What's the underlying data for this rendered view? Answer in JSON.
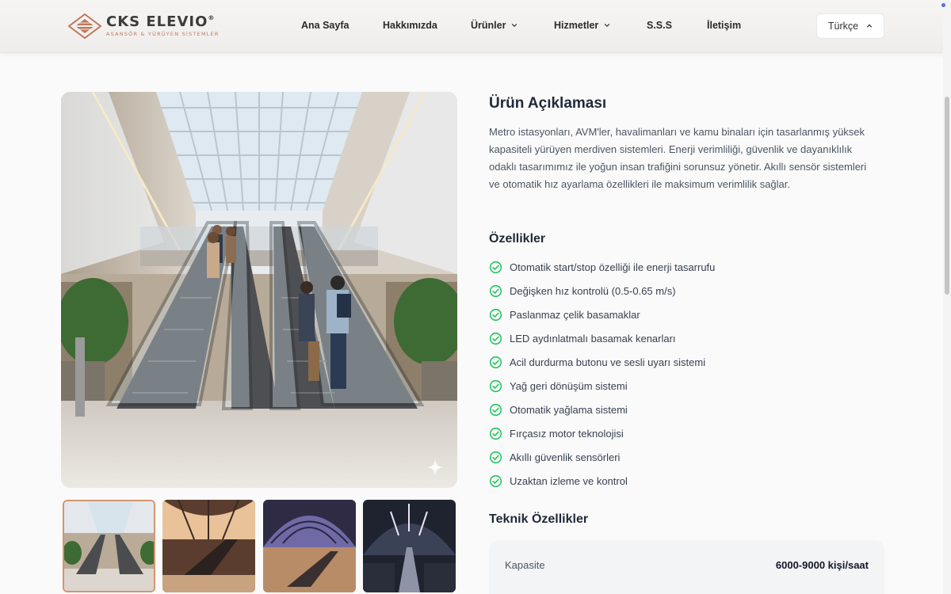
{
  "brand": {
    "name": "CKS ELEVIO",
    "registered": "®",
    "tagline": "ASANSÖR & YÜRÜYEN SİSTEMLER",
    "colors": {
      "accent": "#c0775a",
      "text": "#3c3c3c"
    }
  },
  "nav": {
    "items": [
      {
        "label": "Ana Sayfa",
        "has_dropdown": false
      },
      {
        "label": "Hakkımızda",
        "has_dropdown": false
      },
      {
        "label": "Ürünler",
        "has_dropdown": true
      },
      {
        "label": "Hizmetler",
        "has_dropdown": true
      },
      {
        "label": "S.S.S",
        "has_dropdown": false
      },
      {
        "label": "İletişim",
        "has_dropdown": false
      }
    ],
    "language": "Türkçe"
  },
  "gallery": {
    "active_index": 0,
    "thumbnail_count": 4
  },
  "product": {
    "description_title": "Ürün Açıklaması",
    "description": "Metro istasyonları, AVM'ler, havalimanları ve kamu binaları için tasarlanmış yüksek kapasiteli yürüyen merdiven sistemleri. Enerji verimliliği, güvenlik ve dayanıklılık odaklı tasarımımız ile yoğun insan trafiğini sorunsuz yönetir. Akıllı sensör sistemleri ve otomatik hız ayarlama özellikleri ile maksimum verimlilik sağlar.",
    "features_title": "Özellikler",
    "features": [
      "Otomatik start/stop özelliği ile enerji tasarrufu",
      "Değişken hız kontrolü (0.5-0.65 m/s)",
      "Paslanmaz çelik basamaklar",
      "LED aydınlatmalı basamak kenarları",
      "Acil durdurma butonu ve sesli uyarı sistemi",
      "Yağ geri dönüşüm sistemi",
      "Otomatik yağlama sistemi",
      "Fırçasız motor teknolojisi",
      "Akıllı güvenlik sensörleri",
      "Uzaktan izleme ve kontrol"
    ],
    "specs_title": "Teknik Özellikler",
    "specs": [
      {
        "label": "Kapasite",
        "value": "6000-9000 kişi/saat"
      }
    ]
  },
  "icons": {
    "check": "check-circle-icon",
    "chevron": "chevron-down-icon",
    "sparkle": "sparkle-icon"
  },
  "colors": {
    "check_green": "#22c55e",
    "heading": "#1f2937",
    "body_text": "#4b5563",
    "thumb_active_border": "#d4956f"
  }
}
